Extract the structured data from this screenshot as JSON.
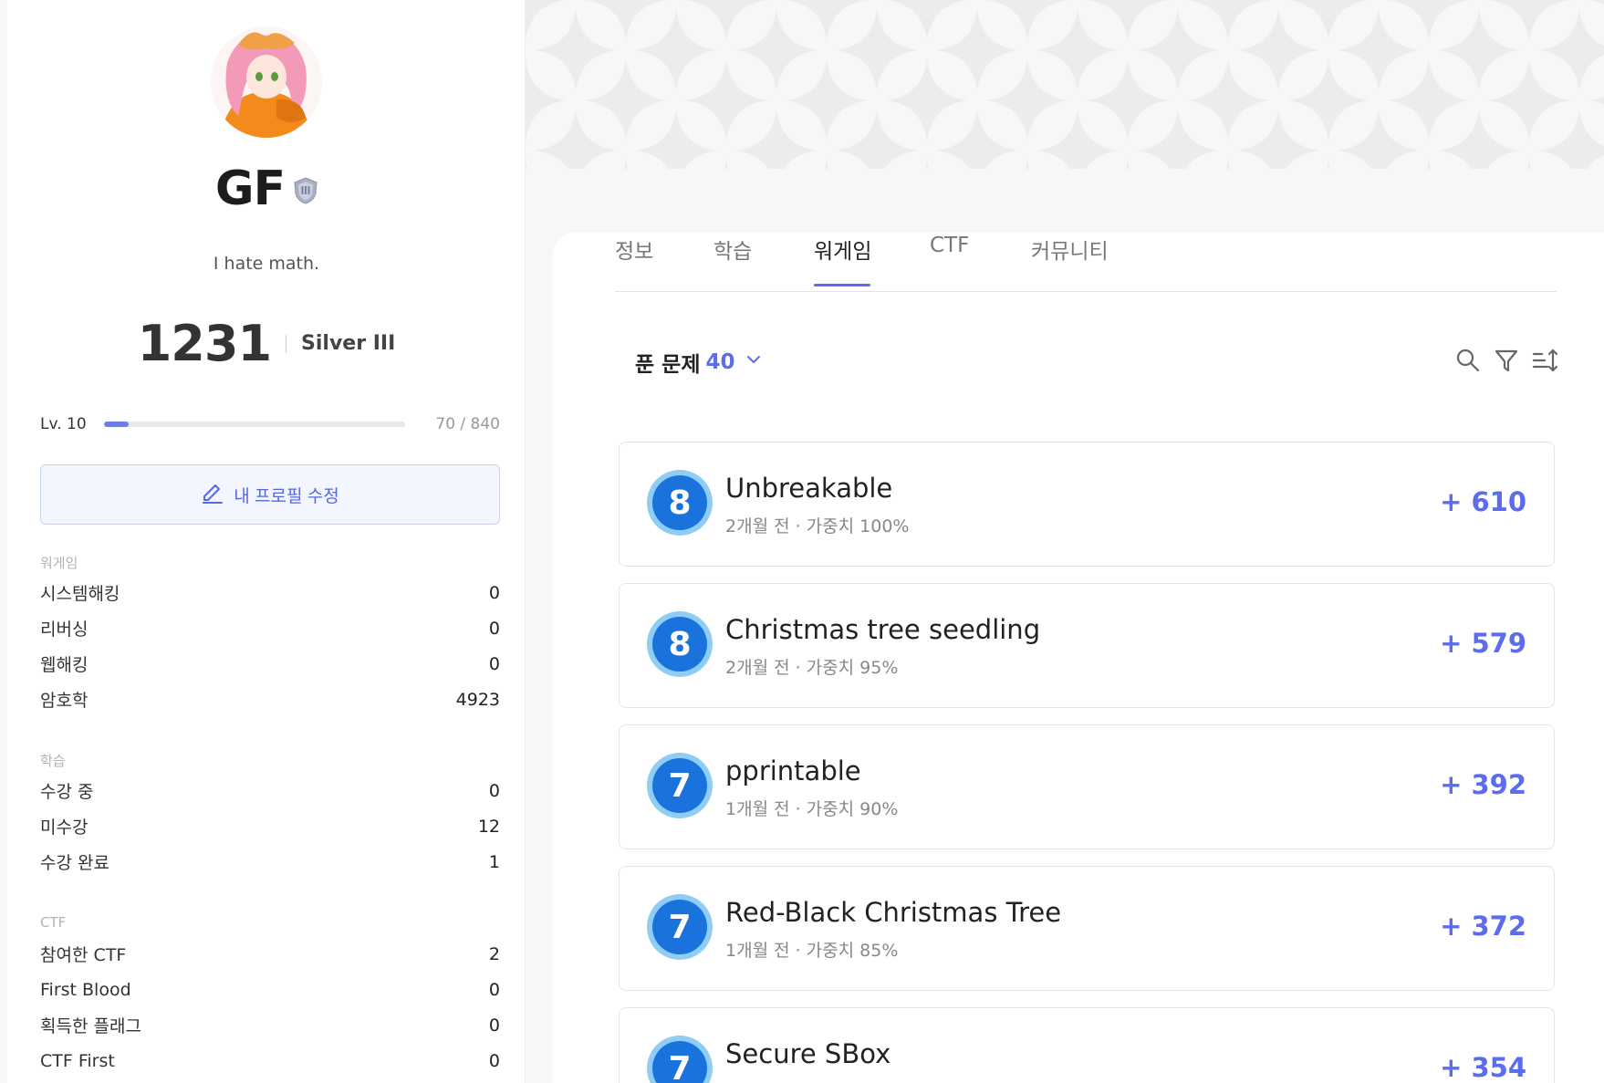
{
  "profile": {
    "nickname": "GF",
    "bio": "I hate math.",
    "rating": "1231",
    "tier": "Silver III",
    "level_label": "Lv. 10",
    "exp_text": "70 / 840",
    "exp_progress": 0.083,
    "edit_button_label": "내 프로필 수정"
  },
  "stats": {
    "wargame": {
      "title": "워게임",
      "rows": [
        {
          "label": "시스템해킹",
          "value": "0"
        },
        {
          "label": "리버싱",
          "value": "0"
        },
        {
          "label": "웹해킹",
          "value": "0"
        },
        {
          "label": "암호학",
          "value": "4923"
        }
      ]
    },
    "learning": {
      "title": "학습",
      "rows": [
        {
          "label": "수강 중",
          "value": "0"
        },
        {
          "label": "미수강",
          "value": "12"
        },
        {
          "label": "수강 완료",
          "value": "1"
        }
      ]
    },
    "ctf": {
      "title": "CTF",
      "rows": [
        {
          "label": "참여한 CTF",
          "value": "2"
        },
        {
          "label": "First Blood",
          "value": "0"
        },
        {
          "label": "획득한 플래그",
          "value": "0"
        },
        {
          "label": "CTF First",
          "value": "0"
        }
      ]
    }
  },
  "tabs": [
    {
      "label": "정보",
      "active": false
    },
    {
      "label": "학습",
      "active": false
    },
    {
      "label": "워게임",
      "active": true
    },
    {
      "label": "CTF",
      "active": false
    },
    {
      "label": "커뮤니티",
      "active": false
    }
  ],
  "solved": {
    "label": "푼 문제",
    "count": "40"
  },
  "problems": [
    {
      "level": "8",
      "title": "Unbreakable",
      "meta": "2개월 전 · 가중치 100%",
      "score": "+ 610"
    },
    {
      "level": "8",
      "title": "Christmas tree seedling",
      "meta": "2개월 전 · 가중치 95%",
      "score": "+ 579"
    },
    {
      "level": "7",
      "title": "pprintable",
      "meta": "1개월 전 · 가중치 90%",
      "score": "+ 392"
    },
    {
      "level": "7",
      "title": "Red-Black Christmas Tree",
      "meta": "1개월 전 · 가중치 85%",
      "score": "+ 372"
    },
    {
      "level": "7",
      "title": "Secure SBox",
      "meta": "",
      "score": "+ 354"
    }
  ],
  "icons": {
    "tier_badge": "shield-tier-icon",
    "edit": "pencil-icon",
    "dropdown": "chevron-down-icon",
    "search": "search-icon",
    "filter": "filter-icon",
    "sort": "sort-icon"
  },
  "colors": {
    "accent": "#5b6cf0",
    "level_badge": "#1a73dc"
  }
}
